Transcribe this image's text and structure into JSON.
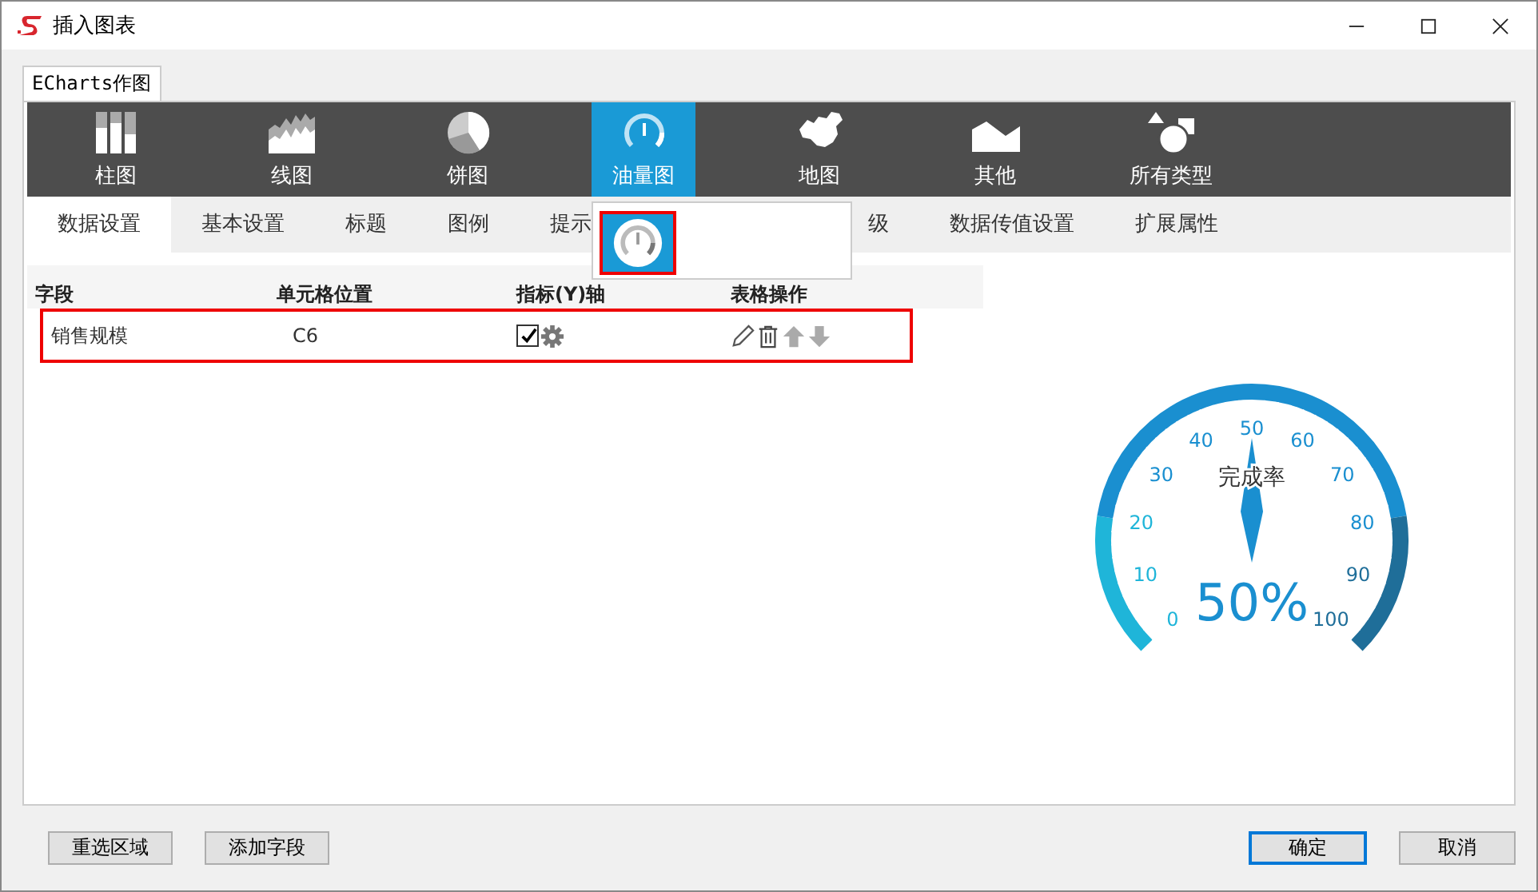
{
  "window": {
    "title": "插入图表"
  },
  "tabs": [
    {
      "label": "ECharts作图",
      "selected": true
    }
  ],
  "chart_types": [
    {
      "label": "柱图",
      "kind": "bar",
      "selected": false
    },
    {
      "label": "线图",
      "kind": "line",
      "selected": false
    },
    {
      "label": "饼图",
      "kind": "pie",
      "selected": false
    },
    {
      "label": "油量图",
      "kind": "gauge",
      "selected": true
    },
    {
      "label": "地图",
      "kind": "map",
      "selected": false
    },
    {
      "label": "其他",
      "kind": "other",
      "selected": false
    },
    {
      "label": "所有类型",
      "kind": "all",
      "selected": false
    }
  ],
  "type_popup": {
    "options": [
      {
        "kind": "gauge",
        "selected": true
      }
    ]
  },
  "settings_tabs": [
    {
      "label": "数据设置",
      "selected": true
    },
    {
      "label": "基本设置",
      "selected": false
    },
    {
      "label": "标题",
      "selected": false
    },
    {
      "label": "图例",
      "selected": false
    },
    {
      "label": "提示",
      "selected": false
    },
    {
      "label": "级",
      "selected": false,
      "covered_before": true
    },
    {
      "label": "数据传值设置",
      "selected": false
    },
    {
      "label": "扩展属性",
      "selected": false
    }
  ],
  "table": {
    "columns": [
      "字段",
      "单元格位置",
      "指标(Y)轴",
      "表格操作"
    ],
    "rows": [
      {
        "field": "销售规模",
        "cell": "C6",
        "axis_checked": true,
        "highlighted": true
      }
    ]
  },
  "gauge": {
    "title": "完成率",
    "value_label": "50%",
    "level": 0.5,
    "ticks": [
      "0",
      "10",
      "20",
      "30",
      "40",
      "50",
      "60",
      "70",
      "80",
      "90",
      "100"
    ]
  },
  "left_buttons": [
    {
      "label": "重选区域",
      "default": false
    },
    {
      "label": "添加字段",
      "default": false
    }
  ],
  "right_buttons": [
    {
      "label": "确定",
      "default": true
    },
    {
      "label": "取消",
      "default": false
    }
  ]
}
